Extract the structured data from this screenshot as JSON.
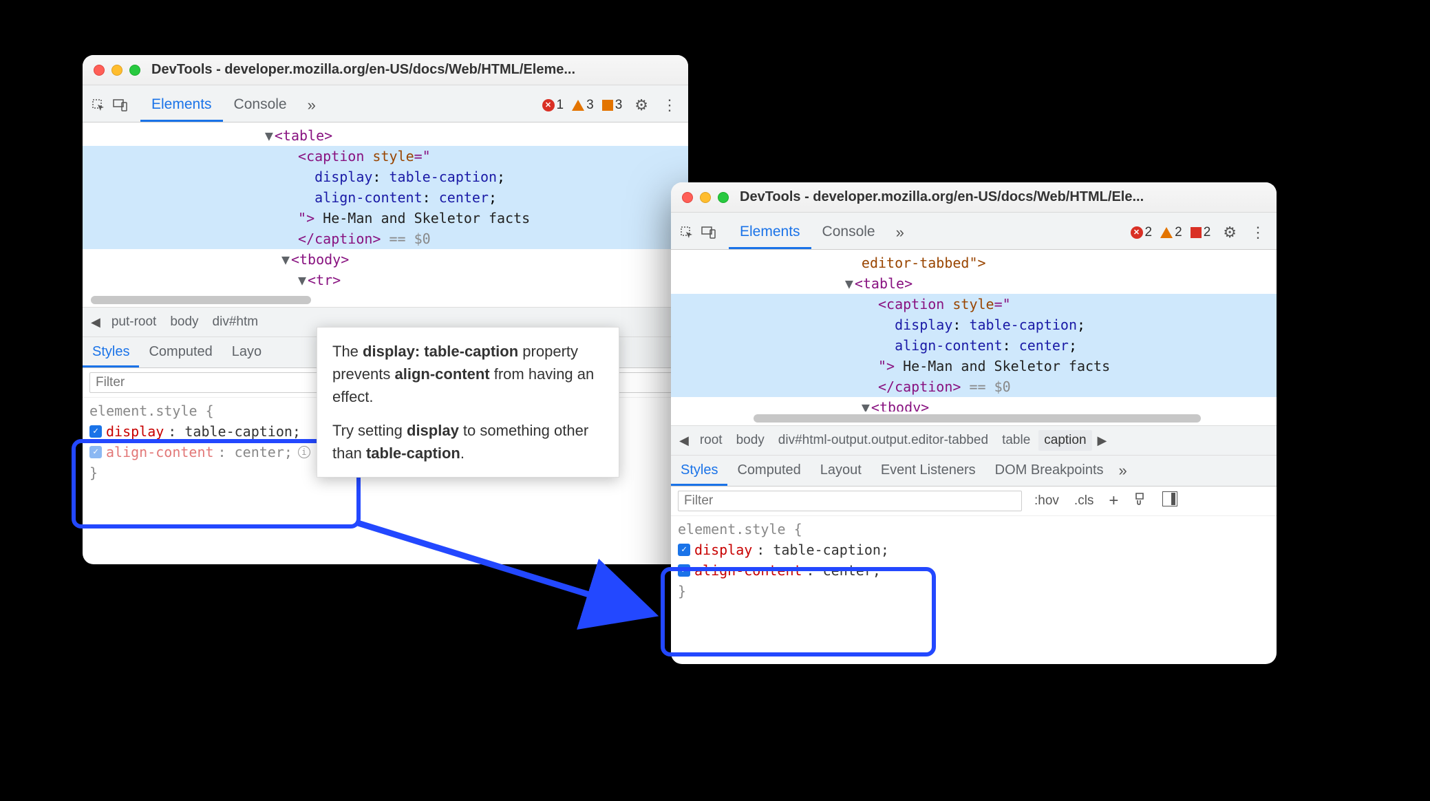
{
  "windowA": {
    "title": "DevTools - developer.mozilla.org/en-US/docs/Web/HTML/Eleme...",
    "tabs": {
      "elements": "Elements",
      "console": "Console",
      "more": "»"
    },
    "status": {
      "errors": "1",
      "warnings": "3",
      "flags": "3"
    },
    "dom": {
      "l1": "<table>",
      "l2a": "<caption ",
      "l2b": "style",
      "l2c": "=\"",
      "l3a": "display",
      "l3b": ": ",
      "l3c": "table-caption",
      "l3d": ";",
      "l4a": "align-content",
      "l4b": ": ",
      "l4c": "center",
      "l4d": ";",
      "l5a": "\"> ",
      "l5b": "He-Man and Skeletor facts",
      "l6a": "</caption>",
      "l6b": " == $0",
      "l7": "<tbody>",
      "l8": "<tr>"
    },
    "crumbs": {
      "c1": "put-root",
      "c2": "body",
      "c3": "div#htm"
    },
    "subtabs": {
      "styles": "Styles",
      "computed": "Computed",
      "layout": "Layo"
    },
    "filter": "Filter",
    "rules": {
      "selector": "element.style {",
      "p1k": "display",
      "p1v": ": table-caption;",
      "p2k": "align-content",
      "p2v": ": center;",
      "close": "}"
    }
  },
  "tooltip": {
    "line1a": "The ",
    "line1b": "display: table-caption",
    "line1c": " property prevents ",
    "line1d": "align-content",
    "line1e": " from having an effect.",
    "line2a": "Try setting ",
    "line2b": "display",
    "line2c": " to something other than ",
    "line2d": "table-caption",
    "line2e": "."
  },
  "windowB": {
    "title": "DevTools - developer.mozilla.org/en-US/docs/Web/HTML/Ele...",
    "tabs": {
      "elements": "Elements",
      "console": "Console",
      "more": "»"
    },
    "status": {
      "errors": "2",
      "warnings": "2",
      "flags": "2"
    },
    "dom": {
      "l0": "editor-tabbed\">",
      "l1": "<table>",
      "l2a": "<caption ",
      "l2b": "style",
      "l2c": "=\"",
      "l3a": "display",
      "l3b": ": ",
      "l3c": "table-caption",
      "l3d": ";",
      "l4a": "align-content",
      "l4b": ": ",
      "l4c": "center",
      "l4d": ";",
      "l5a": "\"> ",
      "l5b": "He-Man and Skeletor facts",
      "l6a": "</caption>",
      "l6b": " == $0",
      "l7": "<tbody>"
    },
    "crumbs": {
      "c1": "root",
      "c2": "body",
      "c3": "div#html-output.output.editor-tabbed",
      "c4": "table",
      "c5": "caption"
    },
    "subtabs": {
      "styles": "Styles",
      "computed": "Computed",
      "layout": "Layout",
      "evt": "Event Listeners",
      "dom": "DOM Breakpoints",
      "more": "»"
    },
    "filter": "Filter",
    "tools": {
      "hov": ":hov",
      "cls": ".cls"
    },
    "rules": {
      "selector": "element.style {",
      "p1k": "display",
      "p1v": ": table-caption;",
      "p2k": "align-content",
      "p2v": ": center;",
      "close": "}"
    }
  }
}
